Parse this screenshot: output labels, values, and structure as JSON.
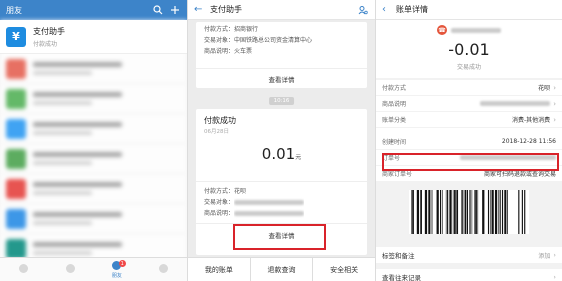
{
  "panel1": {
    "title": "朋友",
    "first": {
      "name": "支付助手",
      "sub": "付款成功",
      "icon": "¥"
    },
    "avatar_colors": [
      "#e65a4a",
      "#4caf50",
      "#2196f3",
      "#43a047",
      "#e53935",
      "#1e88e5",
      "#00897b",
      "#8d6e63"
    ],
    "tab_badge": "1",
    "tab_active_label": "朋友",
    "accent": "#3d84c9"
  },
  "panel2": {
    "title": "支付助手",
    "card1": {
      "rows": [
        {
          "k": "付款方式：",
          "v": "招商银行"
        },
        {
          "k": "交易对象：",
          "v": "中国铁路总公司资金清算中心"
        },
        {
          "k": "商品说明：",
          "v": "火车票"
        }
      ],
      "detail": "查看详情"
    },
    "time": "10:16",
    "card2": {
      "title": "付款成功",
      "date": "06月28日",
      "amount": "0.01",
      "unit": "元",
      "rows": [
        {
          "k": "付款方式：",
          "v": "花呗"
        },
        {
          "k": "交易对象：",
          "v": ""
        },
        {
          "k": "商品说明：",
          "v": ""
        }
      ],
      "detail": "查看详情"
    },
    "bottom": [
      "我的账单",
      "退款查询",
      "安全相关"
    ]
  },
  "panel3": {
    "title": "账单详情",
    "amount": "-0.01",
    "status": "交易成功",
    "rows": [
      {
        "k": "付款方式",
        "v": "花呗",
        "chevron": true
      },
      {
        "k": "商品说明",
        "v": "",
        "chevron": true
      },
      {
        "k": "账单分类",
        "v": "消费-其他消费",
        "chevron": true
      },
      {
        "k": "创建时间",
        "v": "2018-12-28 11:56",
        "chevron": false
      },
      {
        "k": "订单号",
        "v": "",
        "chevron": false
      },
      {
        "k": "商家订单号",
        "v": "商家可扫码退款或查询交易",
        "chevron": false
      }
    ],
    "tags_label": "标签和备注",
    "tags_value": "添加",
    "records_label": "查看往来记录"
  },
  "colors": {
    "highlight": "#d9232a",
    "brand": "#3d84c9"
  }
}
